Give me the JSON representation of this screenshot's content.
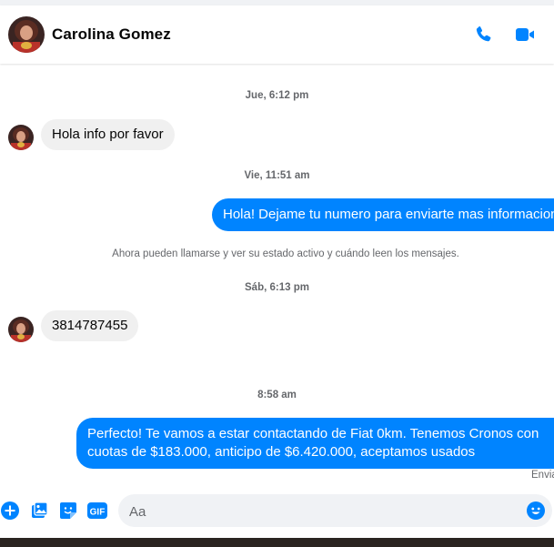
{
  "header": {
    "contact_name": "Carolina Gomez",
    "call_icon": "phone-icon",
    "video_icon": "video-camera-icon"
  },
  "thread": {
    "ts_1": "Jue, 6:12 pm",
    "msg_1": "Hola info por favor",
    "ts_2": "Vie, 11:51 am",
    "msg_2": "Hola! Dejame tu numero para enviarte mas informacion",
    "system_note": "Ahora pueden llamarse y ver su estado activo y cuándo leen los mensajes.",
    "ts_3": "Sáb, 6:13 pm",
    "msg_3": "3814787455",
    "ts_4": "8:58 am",
    "msg_4": "Perfecto! Te vamos a estar contactando de Fiat 0km. Tenemos Cronos con cuotas de $183.000, anticipo de $6.420.000, aceptamos usados",
    "sent_status": "Enviado"
  },
  "composer": {
    "placeholder": "Aa",
    "icons": [
      "plus-circle-icon",
      "image-icon",
      "sticker-icon",
      "gif-icon",
      "emoji-icon"
    ],
    "gif_label": "GIF"
  },
  "colors": {
    "accent": "#0084ff",
    "incoming_bubble": "#f0f0f0",
    "muted_text": "#65676b"
  }
}
